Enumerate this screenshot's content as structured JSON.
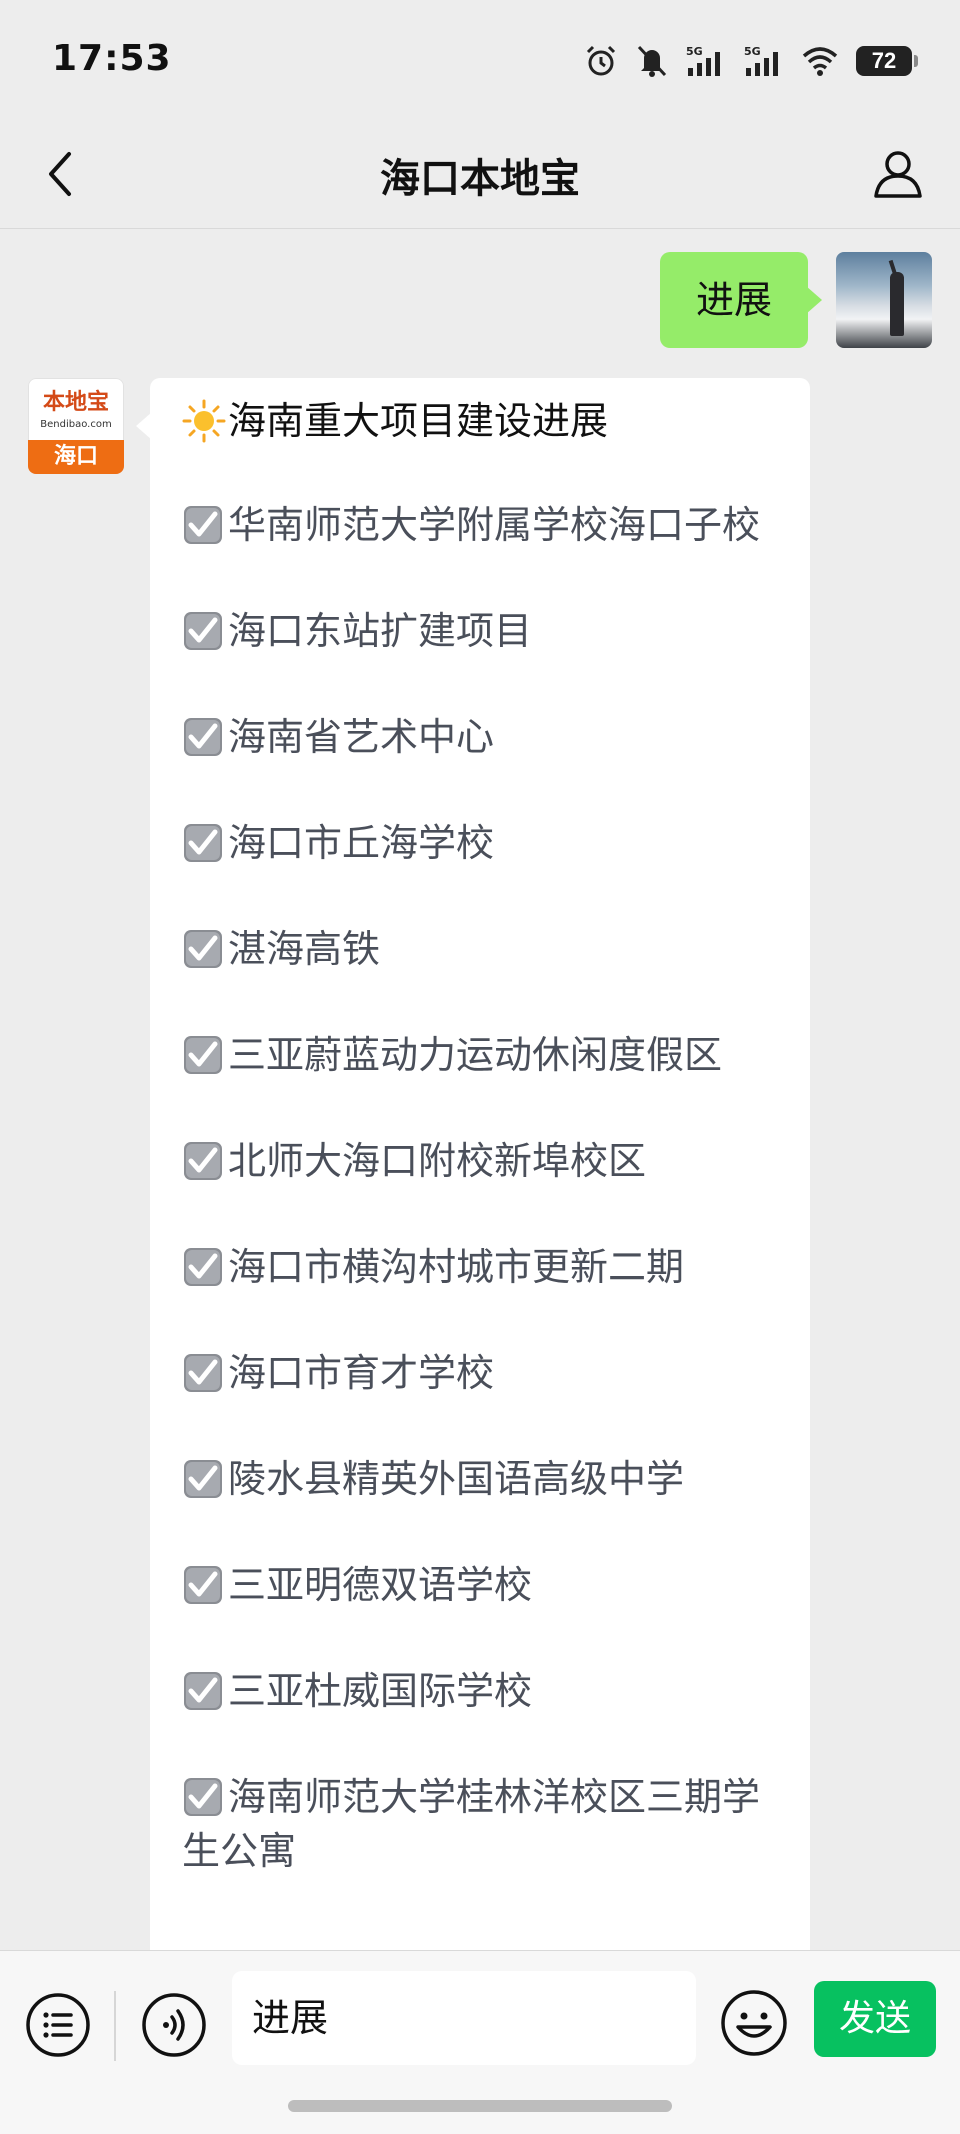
{
  "status_bar": {
    "time": "17:53",
    "battery": "72",
    "icons": [
      "alarm-icon",
      "mute-icon",
      "signal-5g-icon",
      "signal-5g-icon",
      "wifi-icon",
      "battery-icon"
    ]
  },
  "header": {
    "title": "海口本地宝",
    "back_icon": "chevron-left-icon",
    "profile_icon": "person-icon"
  },
  "chat": {
    "sent_message": "进展",
    "bot_avatar": {
      "logo_text": "本地宝",
      "logo_url": "Bendibao.com",
      "city": "海口"
    },
    "reply": {
      "heading_icon": "sun-icon",
      "heading": "海南重大项目建设进展",
      "item_icon": "checkbox-checked-icon",
      "items": [
        "华南师范大学附属学校海口子校",
        "海口东站扩建项目",
        "海南省艺术中心",
        "海口市丘海学校",
        "湛海高铁",
        "三亚蔚蓝动力运动休闲度假区",
        "北师大海口附校新埠校区",
        "海口市横沟村城市更新二期",
        "海口市育才学校",
        "陵水县精英外国语高级中学",
        "三亚明德双语学校",
        "三亚杜威国际学校",
        "海南师范大学桂林洋校区三期学生公寓"
      ]
    }
  },
  "input_bar": {
    "text_value": "进展",
    "send_label": "发送",
    "accent_color": "#07c160"
  }
}
